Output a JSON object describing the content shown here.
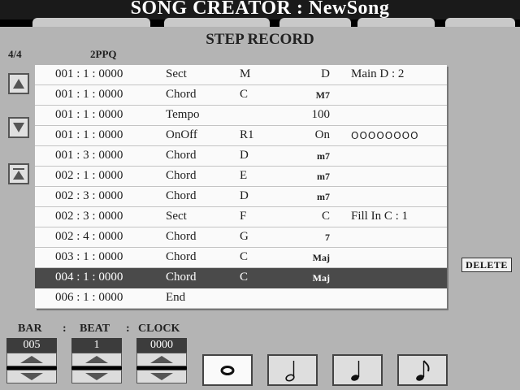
{
  "window": {
    "title": "SONG CREATOR : NewSong"
  },
  "panel": {
    "title": "STEP RECORD",
    "time_signature": "4/4",
    "resolution": "2PPQ"
  },
  "side_buttons": {
    "up_icon": "triangle-up-icon",
    "down_icon": "triangle-down-icon",
    "top_icon": "jump-to-top-icon"
  },
  "events": [
    {
      "position": "001 : 1 : 0000",
      "type": "Sect",
      "data1": "M",
      "data2": "D",
      "data3": "Main D   : 2"
    },
    {
      "position": "001 : 1 : 0000",
      "type": "Chord",
      "data1": "C",
      "data2": "M7",
      "data3": ""
    },
    {
      "position": "001 : 1 : 0000",
      "type": "Tempo",
      "data1": "",
      "data2": "100",
      "data3": ""
    },
    {
      "position": "001 : 1 : 0000",
      "type": "OnOff",
      "data1": "R1",
      "data2": "On",
      "data3": "OOOOOOOO"
    },
    {
      "position": "001 : 3 : 0000",
      "type": "Chord",
      "data1": "D",
      "data2": "m7",
      "data3": ""
    },
    {
      "position": "002 : 1 : 0000",
      "type": "Chord",
      "data1": "E",
      "data2": "m7",
      "data3": ""
    },
    {
      "position": "002 : 3 : 0000",
      "type": "Chord",
      "data1": "D",
      "data2": "m7",
      "data3": ""
    },
    {
      "position": "002 : 3 : 0000",
      "type": "Sect",
      "data1": "F",
      "data2": "C",
      "data3": "Fill In C  : 1"
    },
    {
      "position": "002 : 4 : 0000",
      "type": "Chord",
      "data1": "G",
      "data2": "7",
      "data3": ""
    },
    {
      "position": "003 : 1 : 0000",
      "type": "Chord",
      "data1": "C",
      "data2": "Maj",
      "data3": ""
    },
    {
      "position": "004 : 1 : 0000",
      "type": "Chord",
      "data1": "C",
      "data2": "Maj",
      "data3": ""
    },
    {
      "position": "006 : 1 : 0000",
      "type": "End",
      "data1": "",
      "data2": "",
      "data3": ""
    }
  ],
  "selected_event_index": 10,
  "delete_label": "DELETE",
  "locator": {
    "bar_label": "BAR",
    "sep1": ":",
    "beat_label": "BEAT",
    "sep2": ":",
    "clock_label": "CLOCK",
    "bar_value": "005",
    "beat_value": "1",
    "clock_value": "0000"
  },
  "note_lengths": [
    {
      "icon": "whole-note-icon"
    },
    {
      "icon": "half-note-icon"
    },
    {
      "icon": "quarter-note-icon"
    },
    {
      "icon": "eighth-note-icon"
    }
  ],
  "active_note_length_index": 0
}
